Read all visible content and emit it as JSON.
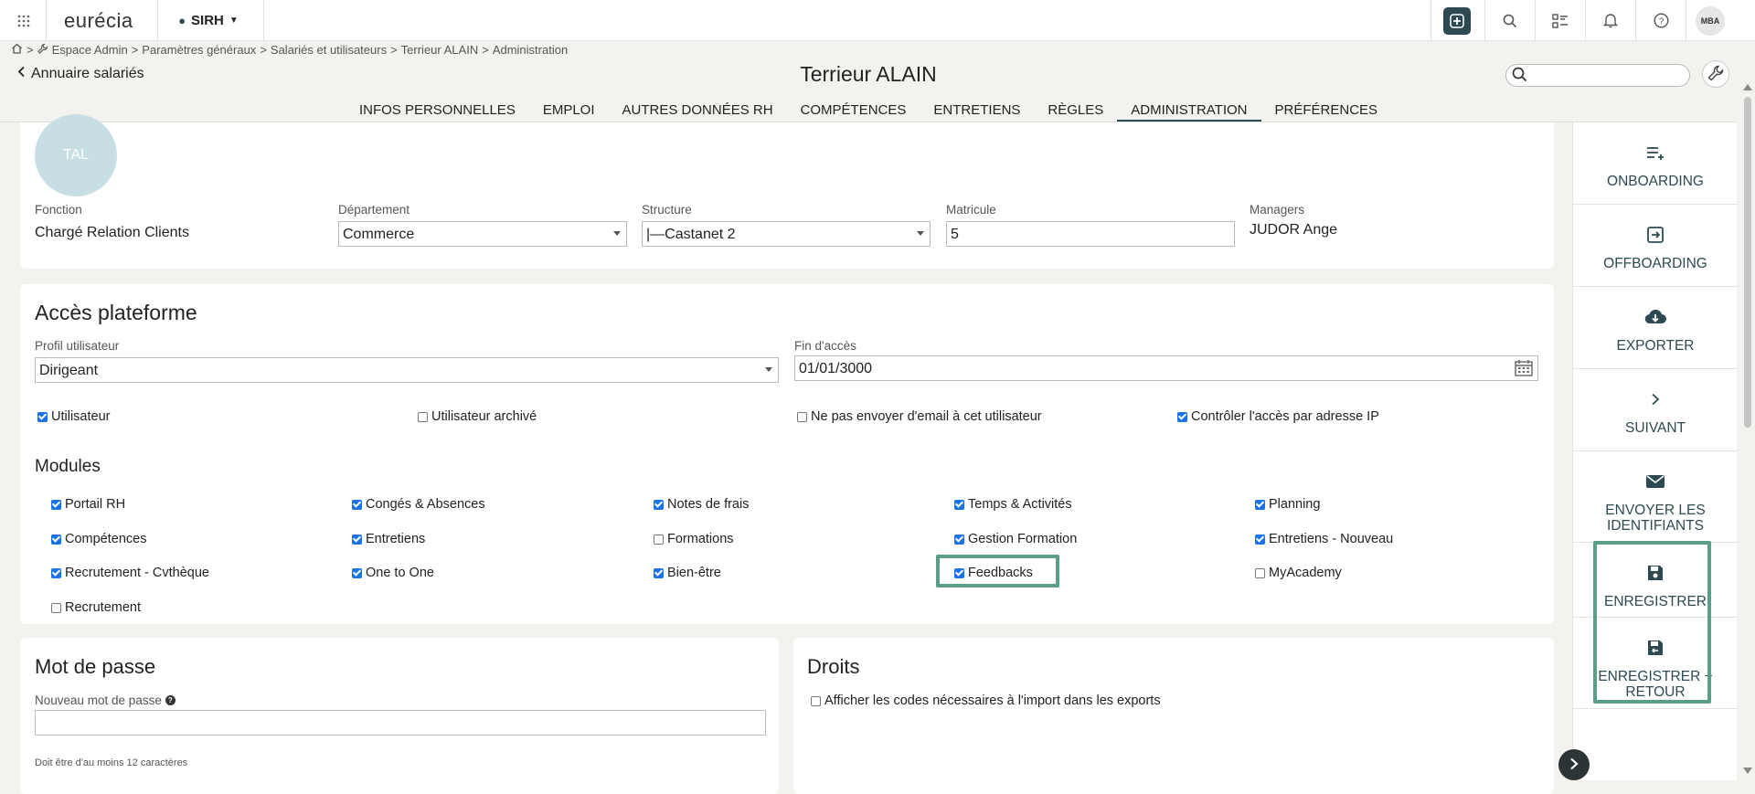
{
  "topbar": {
    "logo": "eurécia",
    "app_selector": "SIRH",
    "user_initials": "MBA"
  },
  "breadcrumb": [
    "Espace Admin",
    "Paramètres généraux",
    "Salariés et utilisateurs",
    "Terrieur ALAIN",
    "Administration"
  ],
  "breadcrumb_sep": ">",
  "back_link": "Annuaire salariés",
  "page_title": "Terrieur ALAIN",
  "search": {
    "placeholder": ""
  },
  "tabs": [
    {
      "label": "INFOS PERSONNELLES",
      "active": false
    },
    {
      "label": "EMPLOI",
      "active": false
    },
    {
      "label": "AUTRES DONNÉES RH",
      "active": false
    },
    {
      "label": "COMPÉTENCES",
      "active": false
    },
    {
      "label": "ENTRETIENS",
      "active": false
    },
    {
      "label": "RÈGLES",
      "active": false
    },
    {
      "label": "ADMINISTRATION",
      "active": true
    },
    {
      "label": "PRÉFÉRENCES",
      "active": false
    }
  ],
  "profile": {
    "avatar_initials": "TAL",
    "fonction_label": "Fonction",
    "fonction_value": "Chargé Relation Clients",
    "departement_label": "Département",
    "departement_value": "Commerce",
    "structure_label": "Structure",
    "structure_value": "|—Castanet 2",
    "matricule_label": "Matricule",
    "matricule_value": "5",
    "managers_label": "Managers",
    "managers_value": "JUDOR Ange"
  },
  "acces": {
    "title": "Accès plateforme",
    "profil_label": "Profil utilisateur",
    "profil_value": "Dirigeant",
    "fin_label": "Fin d'accès",
    "fin_value": "01/01/3000",
    "options": [
      {
        "label": "Utilisateur",
        "checked": true
      },
      {
        "label": "Utilisateur archivé",
        "checked": false
      },
      {
        "label": "Ne pas envoyer d'email à cet utilisateur",
        "checked": false
      },
      {
        "label": "Contrôler l'accès par adresse IP",
        "checked": true
      }
    ],
    "modules_title": "Modules",
    "modules": [
      {
        "label": "Portail RH",
        "checked": true
      },
      {
        "label": "Congés & Absences",
        "checked": true
      },
      {
        "label": "Notes de frais",
        "checked": true
      },
      {
        "label": "Temps & Activités",
        "checked": true
      },
      {
        "label": "Planning",
        "checked": true
      },
      {
        "label": "Compétences",
        "checked": true
      },
      {
        "label": "Entretiens",
        "checked": true
      },
      {
        "label": "Formations",
        "checked": false
      },
      {
        "label": "Gestion Formation",
        "checked": true
      },
      {
        "label": "Entretiens - Nouveau",
        "checked": true
      },
      {
        "label": "Recrutement - Cvthèque",
        "checked": true
      },
      {
        "label": "One to One",
        "checked": true
      },
      {
        "label": "Bien-être",
        "checked": true
      },
      {
        "label": "Feedbacks",
        "checked": true
      },
      {
        "label": "MyAcademy",
        "checked": false
      },
      {
        "label": "Recrutement",
        "checked": false
      }
    ]
  },
  "password": {
    "title": "Mot de passe",
    "label": "Nouveau mot de passe",
    "value": "",
    "hint": "Doit être d'au moins 12 caractères"
  },
  "droits": {
    "title": "Droits",
    "option_label": "Afficher les codes nécessaires à l'import dans les exports",
    "option_checked": false
  },
  "sidebar": [
    {
      "label": "ONBOARDING",
      "icon": "list-add-icon"
    },
    {
      "label": "OFFBOARDING",
      "icon": "exit-icon"
    },
    {
      "label": "EXPORTER",
      "icon": "cloud-download-icon"
    },
    {
      "label": "SUIVANT",
      "icon": "chevron-right-icon"
    },
    {
      "label": "ENVOYER LES IDENTIFIANTS",
      "icon": "mail-icon"
    },
    {
      "label": "ENREGISTRER",
      "icon": "save-icon"
    },
    {
      "label": "ENREGISTRER + RETOUR",
      "icon": "save-return-icon"
    }
  ],
  "colors": {
    "accent": "#2d4a52",
    "highlight": "#5a9e8a",
    "checkbox": "#1a73e8",
    "avatar": "#c7dfe4"
  }
}
